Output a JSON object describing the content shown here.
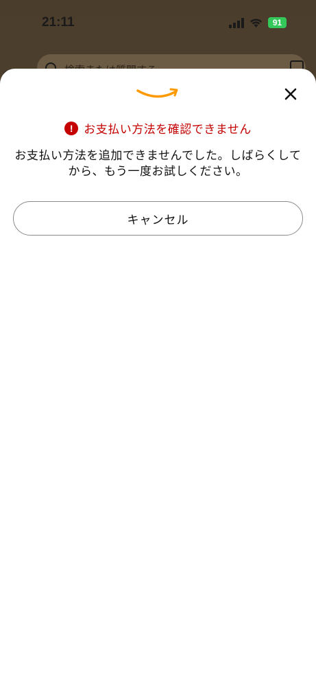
{
  "status_bar": {
    "time": "21:11",
    "battery": "91"
  },
  "background": {
    "search_placeholder": "検索または質問する"
  },
  "sheet": {
    "logo": "amazon-smile-logo",
    "error_title": "お支払い方法を確認できません",
    "message": "お支払い方法を追加できませんでした。しばらくしてから、もう一度お試しください。",
    "cancel_label": "キャンセル"
  },
  "colors": {
    "error": "#c40000",
    "logo_orange": "#ff9900",
    "battery_green": "#34c759"
  }
}
